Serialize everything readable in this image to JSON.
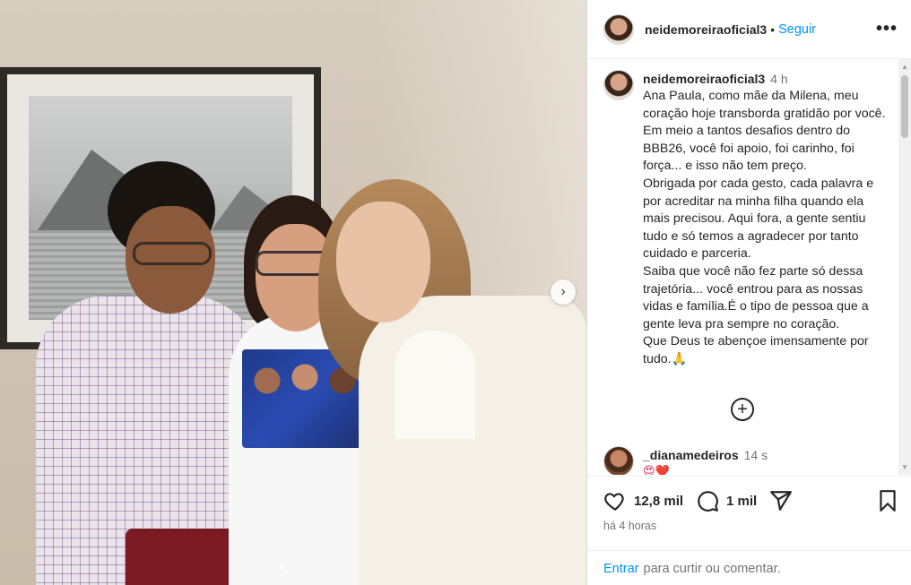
{
  "post": {
    "username": "neidemoreiraoficial3",
    "separator": "•",
    "follow_label": "Seguir",
    "more_icon": "more-options-icon",
    "more_glyph": "•••"
  },
  "caption": {
    "username": "neidemoreiraoficial3",
    "time": "4 h",
    "text": "Ana Paula, como mãe da Milena, meu coração hoje transborda gratidão por você. Em meio a tantos desafios dentro do BBB26, você foi apoio, foi carinho, foi força... e isso não tem preço.\nObrigada por cada gesto, cada palavra e por acreditar na minha filha quando ela mais precisou. Aqui fora, a gente sentiu tudo e só temos a agradecer por tanto cuidado e parceria.\nSaiba que você não fez parte só dessa trajetória... você entrou para as nossas vidas e família.É o tipo de pessoa que a gente leva pra sempre no coração.\nQue Deus te abençoe imensamente por tudo.🙏"
  },
  "load_more_glyph": "+",
  "comments": [
    {
      "username": "_dianamedeiros",
      "time": "14 s",
      "text": "😍❤️"
    }
  ],
  "actions": {
    "likes": "12,8 mil",
    "comments": "1 mil",
    "posted_ago": "há 4 horas"
  },
  "login": {
    "link": "Entrar",
    "text": "para curtir ou comentar."
  },
  "carousel": {
    "next_glyph": "›"
  },
  "scroll": {
    "up_glyph": "▲",
    "down_glyph": "▼"
  },
  "colors": {
    "accent": "#0095f6",
    "muted": "#737373",
    "text": "#262626"
  }
}
